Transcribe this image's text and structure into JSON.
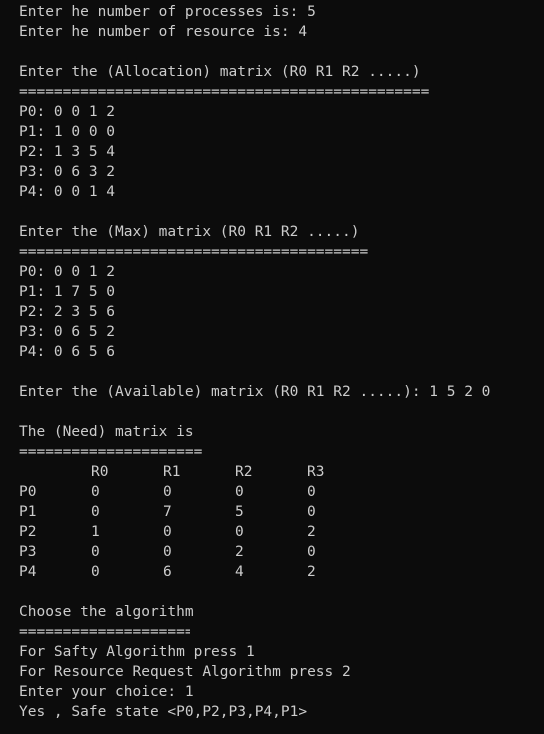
{
  "terminal": {
    "lines_top": [
      "Enter he number of processes is: 5",
      "Enter he number of resource is: 4"
    ],
    "allocation": {
      "prompt": "Enter the (Allocation) matrix (R0 R1 R2 .....)",
      "rule": "===============================================",
      "rows": [
        "P0: 0 0 1 2",
        "P1: 1 0 0 0",
        "P2: 1 3 5 4",
        "P3: 0 6 3 2",
        "P4: 0 0 1 4"
      ]
    },
    "max": {
      "prompt": "Enter the (Max) matrix (R0 R1 R2 .....)",
      "rule": "========================================",
      "rows": [
        "P0: 0 0 1 2",
        "P1: 1 7 5 0",
        "P2: 2 3 5 6",
        "P3: 0 6 5 2",
        "P4: 0 6 5 6"
      ]
    },
    "available": {
      "prompt": "Enter the (Available) matrix (R0 R1 R2 .....): 1 5 2 0"
    },
    "need": {
      "title": "The (Need) matrix is",
      "rule": "=====================",
      "headers": [
        "R0",
        "R1",
        "R2",
        "R3"
      ],
      "rows": [
        {
          "p": "P0",
          "v": [
            "0",
            "0",
            "0",
            "0"
          ]
        },
        {
          "p": "P1",
          "v": [
            "0",
            "7",
            "5",
            "0"
          ]
        },
        {
          "p": "P2",
          "v": [
            "1",
            "0",
            "0",
            "2"
          ]
        },
        {
          "p": "P3",
          "v": [
            "0",
            "0",
            "2",
            "0"
          ]
        },
        {
          "p": "P4",
          "v": [
            "0",
            "6",
            "4",
            "2"
          ]
        }
      ]
    },
    "menu": {
      "title": "Choose the algorithm",
      "rule": "====================",
      "option1": "For Safty Algorithm press 1",
      "option2": "For Resource Request Algorithm press 2",
      "choice": "Enter your choice: 1",
      "result": "Yes , Safe state <P0,P2,P3,P4,P1>"
    }
  }
}
